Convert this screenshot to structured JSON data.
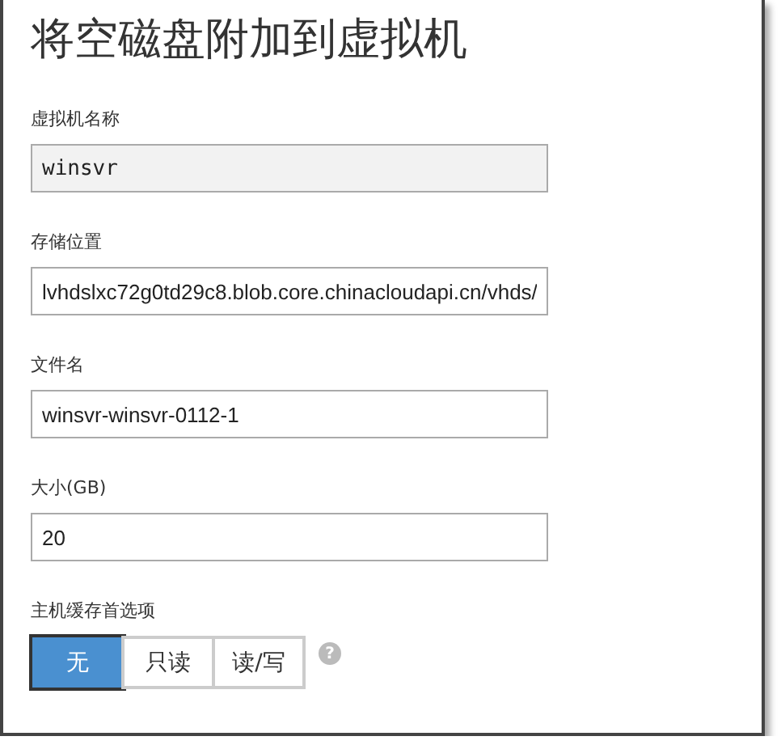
{
  "title": "将空磁盘附加到虚拟机",
  "fields": [
    {
      "label": "虚拟机名称",
      "value": "winsvr",
      "disabled": true
    },
    {
      "label": "存储位置",
      "value": "lvhdslxc72g0td29c8.blob.core.chinacloudapi.cn/vhds/",
      "disabled": false
    },
    {
      "label": "文件名",
      "value": "winsvr-winsvr-0112-1",
      "disabled": false
    },
    {
      "label": "大小(GB)",
      "value": "20",
      "disabled": false
    }
  ],
  "cache": {
    "label": "主机缓存首选项",
    "options": [
      {
        "label": "无",
        "selected": true
      },
      {
        "label": "只读",
        "selected": false
      },
      {
        "label": "读/写",
        "selected": false
      }
    ],
    "help": "?"
  }
}
